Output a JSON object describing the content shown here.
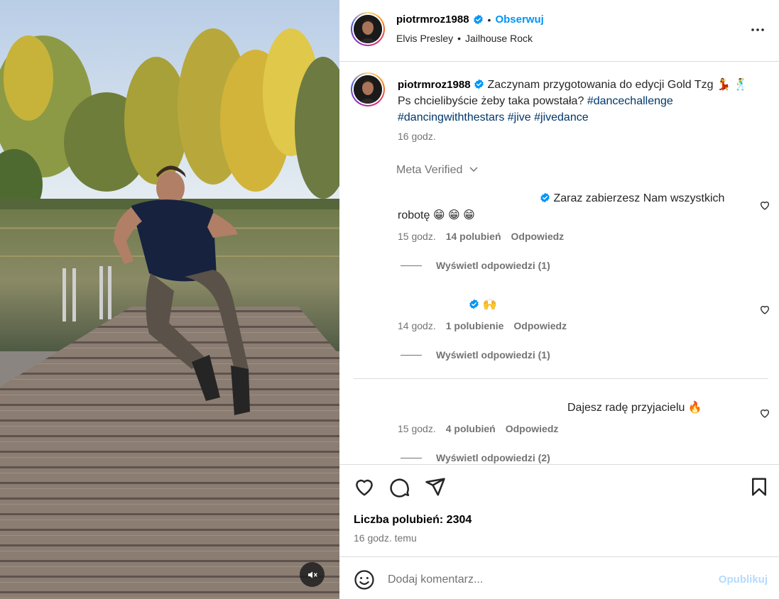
{
  "header": {
    "username": "piotrmroz1988",
    "follow_label": "Obserwuj",
    "artist": "Elvis Presley",
    "song": "Jailhouse Rock",
    "separator": "•",
    "more_icon": "more-horizontal-icon"
  },
  "caption": {
    "username": "piotrmroz1988",
    "text_part1": "Zaczynam przygotowania do edycji Gold Tzg",
    "emojis": "💃 🕺",
    "text_part2": "Ps chcielibyście żeby taka powstała?",
    "hashtags_line1": "#dancechallenge",
    "hashtags_line2": [
      "#dancingwiththestars",
      "#jive",
      "#jivedance"
    ],
    "time": "16 godz.",
    "meta_verified": "Meta Verified"
  },
  "comments": [
    {
      "text_line1": "Zaraz zabierzesz Nam wszystkich",
      "text_line2": "robotę 😁 😁 😁",
      "time": "15 godz.",
      "likes": "14 polubień",
      "reply_label": "Odpowiedz",
      "view_replies": "Wyświetl odpowiedzi (1)"
    },
    {
      "text_line1": "🙌",
      "time": "14 godz.",
      "likes": "1 polubienie",
      "reply_label": "Odpowiedz",
      "view_replies": "Wyświetl odpowiedzi (1)"
    },
    {
      "text_line1": "Dajesz radę przyjacielu 🔥",
      "time": "15 godz.",
      "likes": "4 polubień",
      "reply_label": "Odpowiedz",
      "view_replies": "Wyświetl odpowiedzi (2)"
    }
  ],
  "actions": {
    "like_icon": "heart-icon",
    "comment_icon": "comment-icon",
    "share_icon": "send-icon",
    "save_icon": "bookmark-icon",
    "likes_label": "Liczba polubień: 2304",
    "posted": "16 godz. temu"
  },
  "comment_box": {
    "placeholder": "Dodaj komentarz...",
    "publish_label": "Opublikuj",
    "emoji_icon": "smiley-icon"
  },
  "media": {
    "mute_icon": "muted-speaker-icon"
  },
  "colors": {
    "accent": "#0095f6",
    "hashtag": "#00376b",
    "secondary_text": "#737373",
    "border": "#dbdbdb",
    "publish_disabled": "#b3dbff"
  }
}
